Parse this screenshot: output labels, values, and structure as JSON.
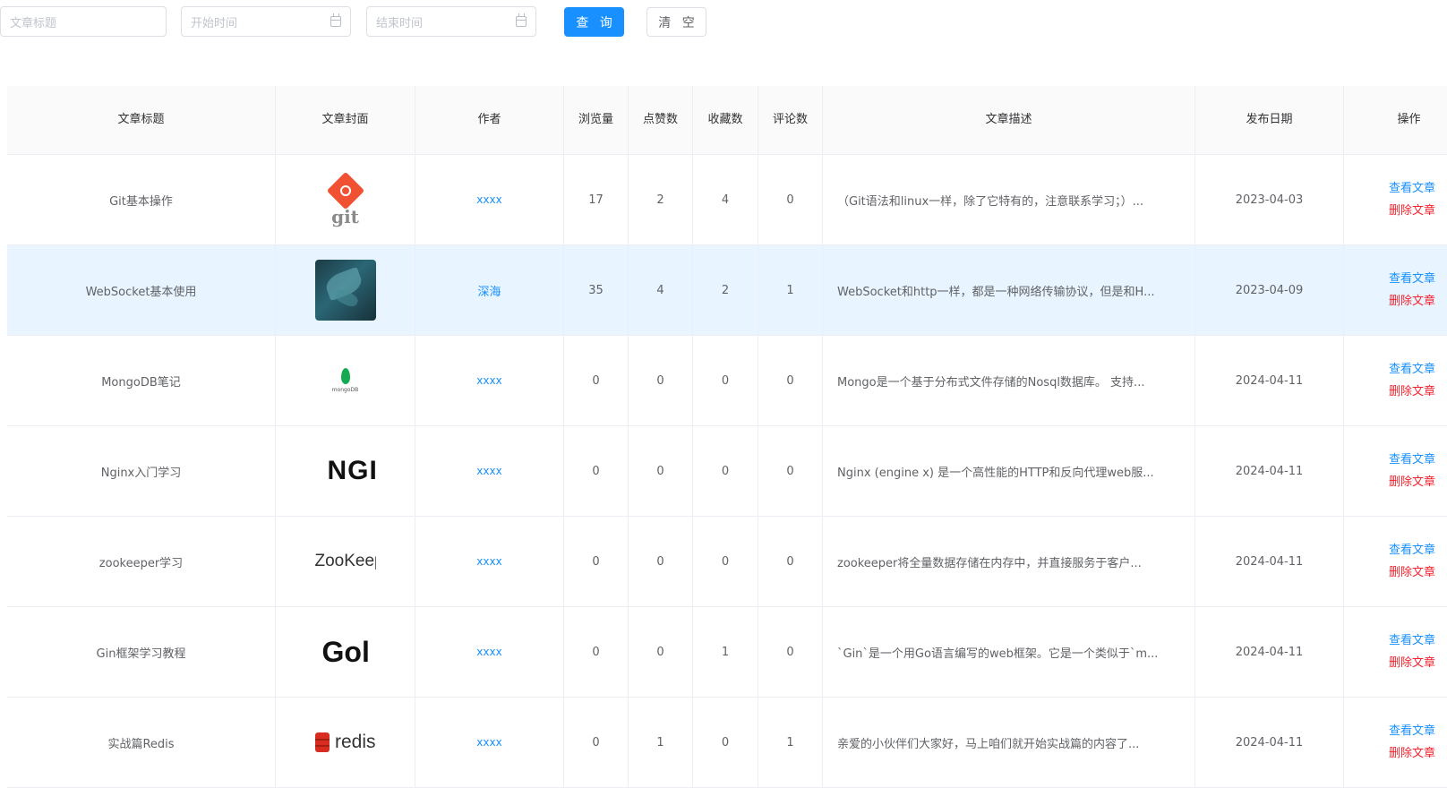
{
  "filters": {
    "title_placeholder": "文章标题",
    "start_placeholder": "开始时间",
    "end_placeholder": "结束时间",
    "query_label": "查 询",
    "clear_label": "清 空"
  },
  "table": {
    "headers": {
      "title": "文章标题",
      "cover": "文章封面",
      "author": "作者",
      "views": "浏览量",
      "likes": "点赞数",
      "favorites": "收藏数",
      "comments": "评论数",
      "description": "文章描述",
      "date": "发布日期",
      "actions": "操作"
    },
    "rows": [
      {
        "title": "Git基本操作",
        "cover": "git-logo-icon",
        "author": "xxxx",
        "views": "17",
        "likes": "2",
        "favorites": "4",
        "comments": "0",
        "description": "（Git语法和linux一样，除了它特有的，注意联系学习；）...",
        "date": "2023-04-03",
        "view_label": "查看文章",
        "delete_label": "删除文章"
      },
      {
        "title": "WebSocket基本使用",
        "cover": "websocket-cover-image",
        "author": "深海",
        "views": "35",
        "likes": "4",
        "favorites": "2",
        "comments": "1",
        "description": "WebSocket和http一样，都是一种网络传输协议，但是和H...",
        "date": "2023-04-09",
        "view_label": "查看文章",
        "delete_label": "删除文章"
      },
      {
        "title": "MongoDB笔记",
        "cover": "mongodb-logo-icon",
        "author": "xxxx",
        "views": "0",
        "likes": "0",
        "favorites": "0",
        "comments": "0",
        "description": "Mongo是一个基于分布式文件存储的Nosql数据库。 支持...",
        "date": "2024-04-11",
        "view_label": "查看文章",
        "delete_label": "删除文章"
      },
      {
        "title": "Nginx入门学习",
        "cover": "nginx-logo-icon",
        "author": "xxxx",
        "views": "0",
        "likes": "0",
        "favorites": "0",
        "comments": "0",
        "description": "Nginx (engine x) 是一个高性能的HTTP和反向代理web服...",
        "date": "2024-04-11",
        "view_label": "查看文章",
        "delete_label": "删除文章"
      },
      {
        "title": "zookeeper学习",
        "cover": "zookeeper-logo-icon",
        "author": "xxxx",
        "views": "0",
        "likes": "0",
        "favorites": "0",
        "comments": "0",
        "description": "zookeeper将全量数据存储在内存中，并直接服务于客户...",
        "date": "2024-04-11",
        "view_label": "查看文章",
        "delete_label": "删除文章"
      },
      {
        "title": "Gin框架学习教程",
        "cover": "golang-logo-icon",
        "author": "xxxx",
        "views": "0",
        "likes": "0",
        "favorites": "1",
        "comments": "0",
        "description": "`Gin`是一个用Go语言编写的web框架。它是一个类似于`m...",
        "date": "2024-04-11",
        "view_label": "查看文章",
        "delete_label": "删除文章"
      },
      {
        "title": "实战篇Redis",
        "cover": "redis-logo-icon",
        "author": "xxxx",
        "views": "0",
        "likes": "1",
        "favorites": "0",
        "comments": "1",
        "description": "亲爱的小伙伴们大家好，马上咱们就开始实战篇的内容了...",
        "date": "2024-04-11",
        "view_label": "查看文章",
        "delete_label": "删除文章"
      }
    ]
  },
  "covers": {
    "git_text": "git",
    "mongo_text": "mongoDB",
    "nginx_text": "NGI",
    "zookeeper_text": "ZooKeeper",
    "gol_text": "Gol",
    "redis_text": "redis"
  },
  "colors": {
    "primary": "#1890ff",
    "danger": "#f5222d",
    "highlight_row": "#e8f4ff"
  }
}
